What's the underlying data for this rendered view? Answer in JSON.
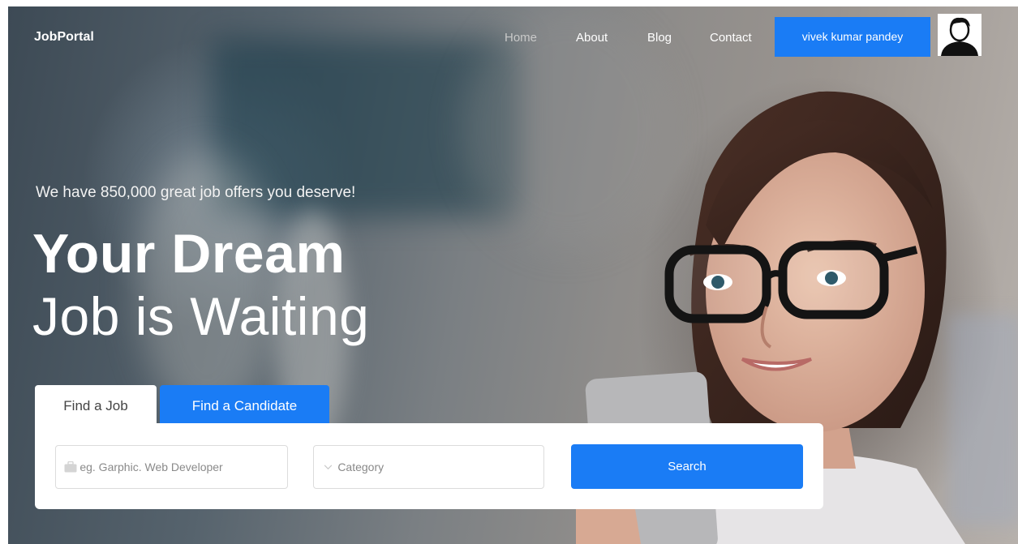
{
  "header": {
    "brand": "JobPortal",
    "nav": [
      {
        "label": "Home"
      },
      {
        "label": "About"
      },
      {
        "label": "Blog"
      },
      {
        "label": "Contact"
      }
    ],
    "user_button": "vivek kumar pandey"
  },
  "hero": {
    "tagline": "We have 850,000 great job offers you deserve!",
    "headline_bold": "Your Dream",
    "headline_light": "Job is Waiting"
  },
  "tabs": {
    "find_job": "Find a Job",
    "find_candidate": "Find a Candidate"
  },
  "search": {
    "keyword_placeholder": "eg. Garphic. Web Developer",
    "category_placeholder": "Category",
    "button": "Search"
  },
  "colors": {
    "accent": "#1a7cf5",
    "nav_active": "#c9c9c9"
  },
  "icons": {
    "keyword": "briefcase-icon",
    "category": "chevron-down-icon",
    "avatar": "user-avatar-icon"
  }
}
